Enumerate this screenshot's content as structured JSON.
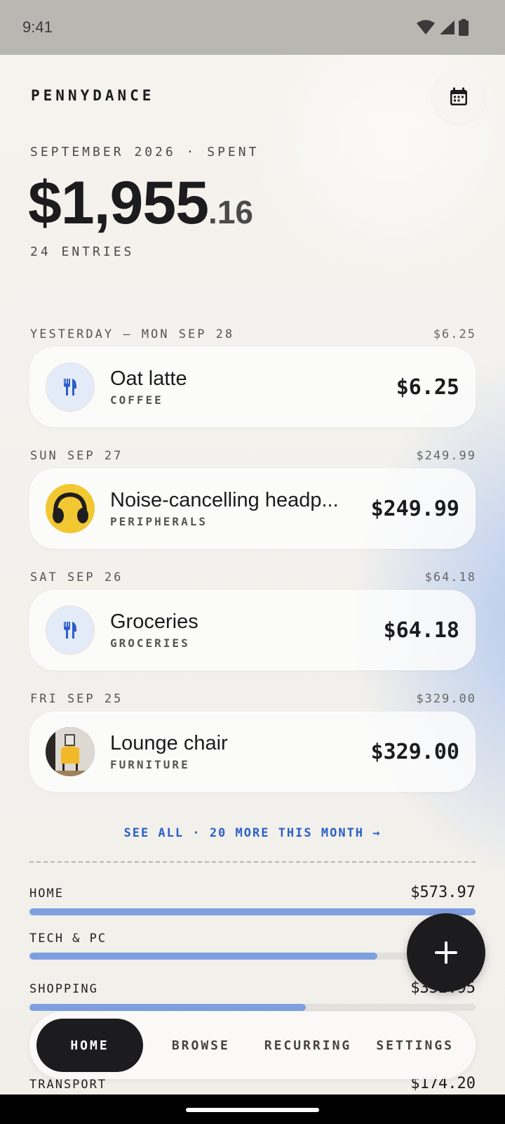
{
  "status": {
    "time": "9:41"
  },
  "header": {
    "brand": "PENNYDANCE",
    "period_label": "SEPTEMBER 2026 · SPENT",
    "total_main": "$1,955",
    "total_cents": ".16",
    "entries": "24 ENTRIES"
  },
  "groups": [
    {
      "date": "YESTERDAY — MON SEP 28",
      "total": "$6.25",
      "item": {
        "title": "Oat latte",
        "category": "COFFEE",
        "amount": "$6.25",
        "icon": "fork-knife-icon"
      }
    },
    {
      "date": "SUN SEP 27",
      "total": "$249.99",
      "item": {
        "title": "Noise-cancelling headp...",
        "category": "PERIPHERALS",
        "amount": "$249.99",
        "icon": "headphones-image"
      }
    },
    {
      "date": "SAT SEP 26",
      "total": "$64.18",
      "item": {
        "title": "Groceries",
        "category": "GROCERIES",
        "amount": "$64.18",
        "icon": "fork-knife-icon"
      }
    },
    {
      "date": "FRI SEP 25",
      "total": "$329.00",
      "item": {
        "title": "Lounge chair",
        "category": "FURNITURE",
        "amount": "$329.00",
        "icon": "chair-image"
      }
    }
  ],
  "see_all": "SEE ALL · 20 MORE THIS MONTH →",
  "categories": [
    {
      "name": "HOME",
      "amount": "$573.97",
      "fill": 1.0
    },
    {
      "name": "TECH & PC",
      "amount": "",
      "fill": 0.78
    },
    {
      "name": "SHOPPING",
      "amount": "$352.95",
      "fill": 0.62
    }
  ],
  "transport": {
    "name": "TRANSPORT",
    "amount": "$174.20"
  },
  "nav": {
    "home": "HOME",
    "browse": "BROWSE",
    "recurring": "RECURRING",
    "settings": "SETTINGS"
  },
  "colors": {
    "accent": "#2a5fc7",
    "bar": "#7f9fe1",
    "dark": "#1c1c1e"
  }
}
